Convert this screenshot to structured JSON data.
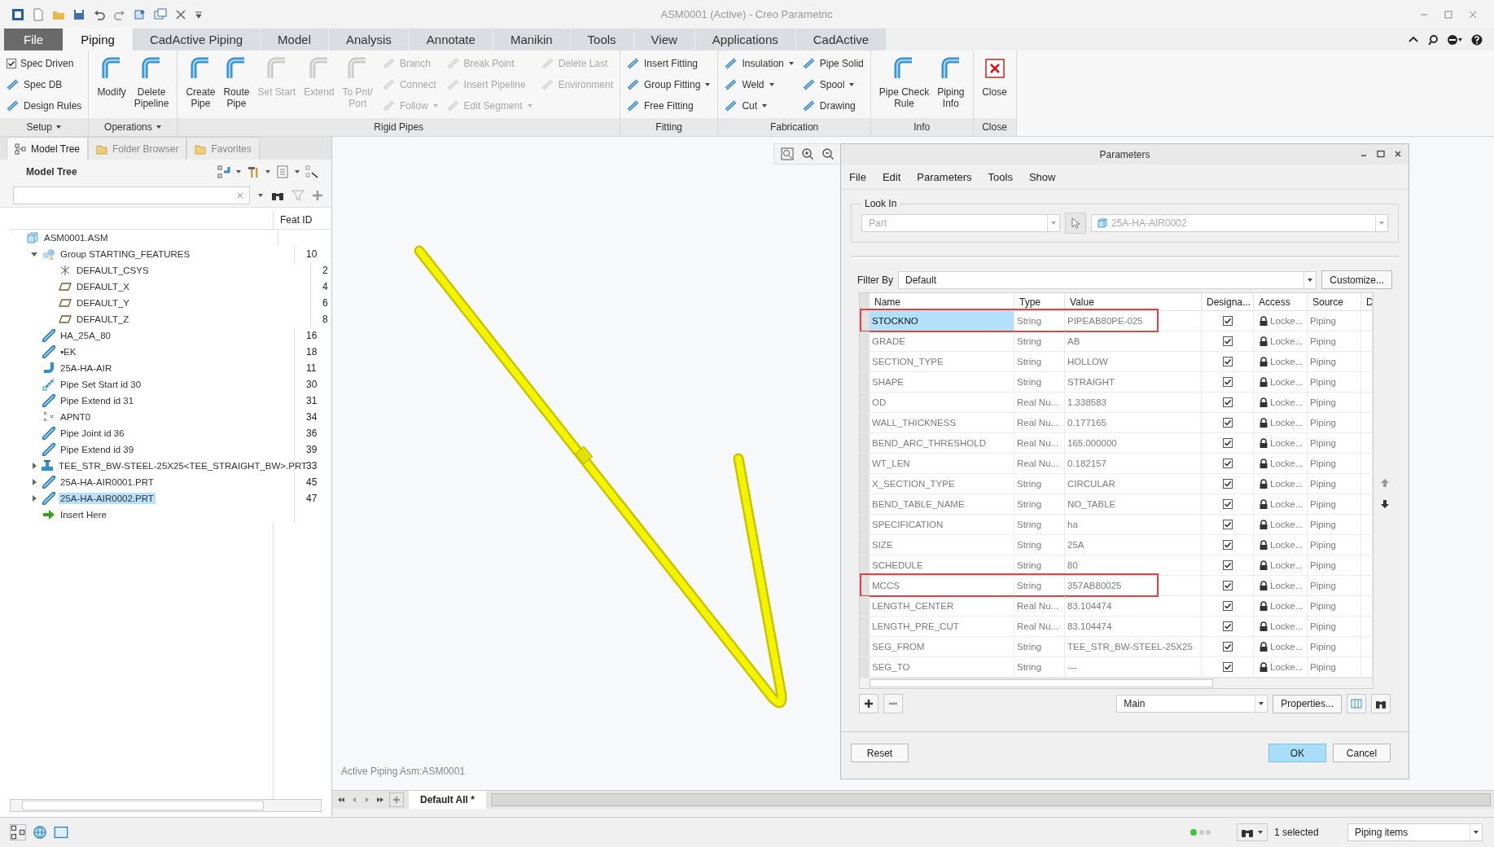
{
  "window": {
    "title": "ASM0001 (Active) - Creo Parametric"
  },
  "tabs": [
    {
      "label": "File",
      "kind": "file",
      "selected": false
    },
    {
      "label": "Piping",
      "kind": "tab",
      "selected": true
    },
    {
      "label": "CadActive Piping",
      "kind": "tab",
      "selected": false
    },
    {
      "label": "Model",
      "kind": "tab",
      "selected": false
    },
    {
      "label": "Analysis",
      "kind": "tab",
      "selected": false
    },
    {
      "label": "Annotate",
      "kind": "tab",
      "selected": false
    },
    {
      "label": "Manikin",
      "kind": "tab",
      "selected": false
    },
    {
      "label": "Tools",
      "kind": "tab",
      "selected": false
    },
    {
      "label": "View",
      "kind": "tab",
      "selected": false
    },
    {
      "label": "Applications",
      "kind": "tab",
      "selected": false
    },
    {
      "label": "CadActive",
      "kind": "tab",
      "selected": false
    }
  ],
  "ribbon": [
    {
      "label": "Setup",
      "menu": true,
      "columns": [
        {
          "kind": "stack",
          "items": [
            {
              "kind": "check",
              "label": "Spec Driven",
              "checked": true,
              "disabled": false
            },
            {
              "kind": "small",
              "label": "Spec DB",
              "disabled": false
            },
            {
              "kind": "small",
              "label": "Design Rules",
              "disabled": false
            }
          ]
        }
      ]
    },
    {
      "label": "Operations",
      "menu": true,
      "columns": [
        {
          "kind": "large",
          "items": [
            {
              "lines": [
                "Modify"
              ],
              "disabled": false
            },
            {
              "lines": [
                "Delete",
                "Pipeline"
              ],
              "disabled": false
            }
          ]
        }
      ]
    },
    {
      "label": "Rigid Pipes",
      "menu": false,
      "columns": [
        {
          "kind": "large",
          "items": [
            {
              "lines": [
                "Create",
                "Pipe"
              ],
              "disabled": false
            },
            {
              "lines": [
                "Route",
                "Pipe"
              ],
              "disabled": false
            },
            {
              "lines": [
                "Set Start"
              ],
              "disabled": true
            },
            {
              "lines": [
                "Extend"
              ],
              "disabled": true
            },
            {
              "lines": [
                "To Pnt/",
                "Port"
              ],
              "disabled": true
            }
          ]
        },
        {
          "kind": "stack",
          "items": [
            {
              "kind": "small",
              "label": "Branch",
              "disabled": true
            },
            {
              "kind": "small",
              "label": "Connect",
              "disabled": true
            },
            {
              "kind": "small",
              "label": "Follow",
              "dropdown": true,
              "disabled": true
            }
          ]
        },
        {
          "kind": "stack",
          "items": [
            {
              "kind": "small",
              "label": "Break Point",
              "disabled": true
            },
            {
              "kind": "small",
              "label": "Insert Pipeline",
              "disabled": true
            },
            {
              "kind": "small",
              "label": "Edit Segment",
              "dropdown": true,
              "disabled": true
            }
          ]
        },
        {
          "kind": "stack",
          "items": [
            {
              "kind": "small",
              "label": "Delete Last",
              "disabled": true
            },
            {
              "kind": "small",
              "label": "Environment",
              "disabled": true
            }
          ]
        }
      ]
    },
    {
      "label": "Fitting",
      "menu": false,
      "columns": [
        {
          "kind": "stack",
          "items": [
            {
              "kind": "small",
              "label": "Insert Fitting",
              "disabled": false
            },
            {
              "kind": "small",
              "label": "Group Fitting",
              "dropdown": true,
              "disabled": false
            },
            {
              "kind": "small",
              "label": "Free Fitting",
              "disabled": false
            }
          ]
        }
      ]
    },
    {
      "label": "Fabrication",
      "menu": false,
      "columns": [
        {
          "kind": "stack",
          "items": [
            {
              "kind": "small",
              "label": "Insulation",
              "dropdown": true,
              "disabled": false
            },
            {
              "kind": "small",
              "label": "Weld",
              "dropdown": true,
              "disabled": false
            },
            {
              "kind": "small",
              "label": "Cut",
              "dropdown": true,
              "disabled": false
            }
          ]
        },
        {
          "kind": "stack",
          "items": [
            {
              "kind": "small",
              "label": "Pipe Solid",
              "disabled": false
            },
            {
              "kind": "small",
              "label": "Spool",
              "dropdown": true,
              "disabled": false
            },
            {
              "kind": "small",
              "label": "Drawing",
              "disabled": false
            }
          ]
        }
      ]
    },
    {
      "label": "Info",
      "menu": false,
      "columns": [
        {
          "kind": "large",
          "items": [
            {
              "lines": [
                "Pipe Check",
                "Rule"
              ],
              "disabled": false
            },
            {
              "lines": [
                "Piping",
                "Info"
              ],
              "disabled": false
            }
          ]
        }
      ]
    },
    {
      "label": "Close",
      "menu": false,
      "columns": [
        {
          "kind": "large",
          "items": [
            {
              "lines": [
                "Close"
              ],
              "kind": "close",
              "disabled": false
            }
          ]
        }
      ]
    }
  ],
  "panel_tabs": [
    {
      "label": "Model Tree",
      "selected": true
    },
    {
      "label": "Folder Browser",
      "selected": false
    },
    {
      "label": "Favorites",
      "selected": false
    }
  ],
  "tree": {
    "title": "Model Tree",
    "column": "Feat ID",
    "items": [
      {
        "name": "ASM0001.ASM",
        "kind": "assembly",
        "selected": false,
        "children": [
          {
            "name": "Group STARTING_FEATURES",
            "kind": "group",
            "feat_id": "10",
            "expanded": true,
            "selected": false,
            "children": [
              {
                "name": "DEFAULT_CSYS",
                "kind": "csys",
                "feat_id": "2",
                "selected": false
              },
              {
                "name": "DEFAULT_X",
                "kind": "plane",
                "feat_id": "4",
                "selected": false
              },
              {
                "name": "DEFAULT_Y",
                "kind": "plane",
                "feat_id": "6",
                "selected": false
              },
              {
                "name": "DEFAULT_Z",
                "kind": "plane",
                "feat_id": "8",
                "selected": false
              }
            ]
          },
          {
            "name": "HA_25A_80",
            "kind": "pipe",
            "feat_id": "16",
            "selected": false
          },
          {
            "name": "▪EK",
            "kind": "pipe",
            "feat_id": "18",
            "selected": false
          },
          {
            "name": "25A-HA-AIR",
            "kind": "route",
            "feat_id": "11",
            "selected": false
          },
          {
            "name": "Pipe Set Start id 30",
            "kind": "start",
            "feat_id": "30",
            "selected": false
          },
          {
            "name": "Pipe Extend id 31",
            "kind": "pipe",
            "feat_id": "31",
            "selected": false
          },
          {
            "name": "APNT0",
            "kind": "point",
            "feat_id": "34",
            "selected": false
          },
          {
            "name": "Pipe Joint id 36",
            "kind": "pipe",
            "feat_id": "36",
            "selected": false
          },
          {
            "name": "Pipe Extend id 39",
            "kind": "pipe",
            "feat_id": "39",
            "selected": false
          },
          {
            "name": "TEE_STR_BW-STEEL-25X25<TEE_STRAIGHT_BW>.PRT",
            "kind": "tee",
            "feat_id": "33",
            "expanded": false,
            "selected": false
          },
          {
            "name": "25A-HA-AIR0001.PRT",
            "kind": "pipe",
            "feat_id": "45",
            "expanded": false,
            "selected": false
          },
          {
            "name": "25A-HA-AIR0002.PRT",
            "kind": "pipe",
            "feat_id": "47",
            "expanded": false,
            "selected": true
          },
          {
            "name": "Insert Here",
            "kind": "insert",
            "selected": false
          }
        ]
      }
    ]
  },
  "viewport": {
    "status": "Active Piping Asm:ASM0001",
    "view_tab": "Default All *"
  },
  "dialog": {
    "title": "Parameters",
    "menu": [
      "File",
      "Edit",
      "Parameters",
      "Tools",
      "Show"
    ],
    "look_in": {
      "legend": "Look In",
      "type": "Part",
      "model": "25A-HA-AIR0002"
    },
    "filter": {
      "label": "Filter By",
      "value": "Default",
      "button": "Customize..."
    },
    "columns": [
      "Name",
      "Type",
      "Value",
      "Designa...",
      "Access",
      "Source",
      "D"
    ],
    "rows": [
      {
        "name": "STOCKNO",
        "type": "String",
        "value": "PIPEAB80PE-025",
        "designate": true,
        "access": "Locke...",
        "source": "Piping",
        "selected": true,
        "highlighted": true
      },
      {
        "name": "GRADE",
        "type": "String",
        "value": "AB",
        "designate": true,
        "access": "Locke...",
        "source": "Piping",
        "selected": false,
        "highlighted": false
      },
      {
        "name": "SECTION_TYPE",
        "type": "String",
        "value": "HOLLOW",
        "designate": true,
        "access": "Locke...",
        "source": "Piping",
        "selected": false,
        "highlighted": false
      },
      {
        "name": "SHAPE",
        "type": "String",
        "value": "STRAIGHT",
        "designate": true,
        "access": "Locke...",
        "source": "Piping",
        "selected": false,
        "highlighted": false
      },
      {
        "name": "OD",
        "type": "Real Nu...",
        "value": "1.338583",
        "designate": true,
        "access": "Locke...",
        "source": "Piping",
        "selected": false,
        "highlighted": false
      },
      {
        "name": "WALL_THICKNESS",
        "type": "Real Nu...",
        "value": "0.177165",
        "designate": true,
        "access": "Locke...",
        "source": "Piping",
        "selected": false,
        "highlighted": false
      },
      {
        "name": "BEND_ARC_THRESHOLD",
        "type": "Real Nu...",
        "value": "165.000000",
        "designate": true,
        "access": "Locke...",
        "source": "Piping",
        "selected": false,
        "highlighted": false
      },
      {
        "name": "WT_LEN",
        "type": "Real Nu...",
        "value": "0.182157",
        "designate": true,
        "access": "Locke...",
        "source": "Piping",
        "selected": false,
        "highlighted": false
      },
      {
        "name": "X_SECTION_TYPE",
        "type": "String",
        "value": "CIRCULAR",
        "designate": true,
        "access": "Locke...",
        "source": "Piping",
        "selected": false,
        "highlighted": false
      },
      {
        "name": "BEND_TABLE_NAME",
        "type": "String",
        "value": "NO_TABLE",
        "designate": true,
        "access": "Locke...",
        "source": "Piping",
        "selected": false,
        "highlighted": false
      },
      {
        "name": "SPECIFICATION",
        "type": "String",
        "value": "ha",
        "designate": true,
        "access": "Locke...",
        "source": "Piping",
        "selected": false,
        "highlighted": false
      },
      {
        "name": "SIZE",
        "type": "String",
        "value": "25A",
        "designate": true,
        "access": "Locke...",
        "source": "Piping",
        "selected": false,
        "highlighted": false
      },
      {
        "name": "SCHEDULE",
        "type": "String",
        "value": "80",
        "designate": true,
        "access": "Locke...",
        "source": "Piping",
        "selected": false,
        "highlighted": false
      },
      {
        "name": "MCCS",
        "type": "String",
        "value": "357AB80025",
        "designate": true,
        "access": "Locke...",
        "source": "Piping",
        "selected": false,
        "highlighted": true
      },
      {
        "name": "LENGTH_CENTER",
        "type": "Real Nu...",
        "value": "83.104474",
        "designate": true,
        "access": "Locke...",
        "source": "Piping",
        "selected": false,
        "highlighted": false
      },
      {
        "name": "LENGTH_PRE_CUT",
        "type": "Real Nu...",
        "value": "83.104474",
        "designate": true,
        "access": "Locke...",
        "source": "Piping",
        "selected": false,
        "highlighted": false
      },
      {
        "name": "SEG_FROM",
        "type": "String",
        "value": "TEE_STR_BW-STEEL-25X25",
        "designate": true,
        "access": "Locke...",
        "source": "Piping",
        "selected": false,
        "highlighted": false
      },
      {
        "name": "SEG_TO",
        "type": "String",
        "value": "---",
        "designate": true,
        "access": "Locke...",
        "source": "Piping",
        "selected": false,
        "highlighted": false
      }
    ],
    "view_select": "Main",
    "properties": "Properties...",
    "buttons": [
      {
        "label": "Reset",
        "kind": "plain"
      },
      {
        "label": "OK",
        "kind": "default"
      },
      {
        "label": "Cancel",
        "kind": "plain"
      }
    ]
  },
  "status_bar": {
    "selection": "1 selected",
    "filter": "Piping items"
  }
}
